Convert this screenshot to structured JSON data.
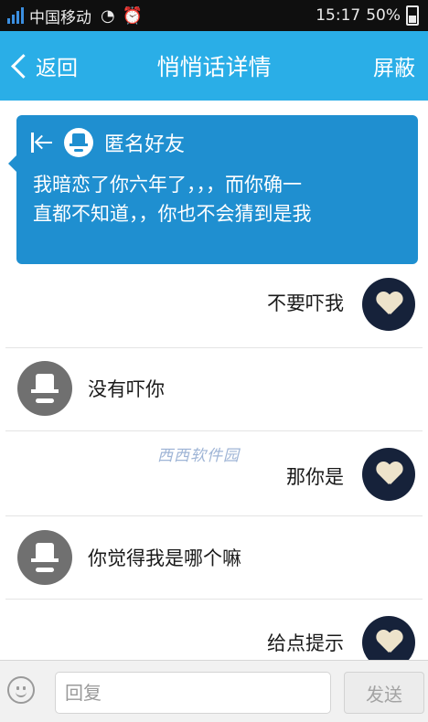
{
  "status_bar": {
    "carrier": "中国移动",
    "time": "15:17",
    "battery": "50%"
  },
  "header": {
    "back_label": "返回",
    "title": "悄悄话详情",
    "block_label": "屏蔽",
    "accent_color": "#2aaee7"
  },
  "detail": {
    "sender_name": "匿名好友",
    "message_line1": "我暗恋了你六年了，，，而你确一",
    "message_line2": "直都不知道，，你也不会猜到是我",
    "card_color": "#1f8fd0"
  },
  "messages": [
    {
      "side": "right",
      "text": "不要吓我"
    },
    {
      "side": "left",
      "text": "没有吓你"
    },
    {
      "side": "right",
      "text": "那你是"
    },
    {
      "side": "left",
      "text": "你觉得我是哪个嘛"
    },
    {
      "side": "right",
      "text": "给点提示"
    }
  ],
  "watermark": "西西软件园",
  "input_bar": {
    "placeholder": "回复",
    "send_label": "发送"
  }
}
